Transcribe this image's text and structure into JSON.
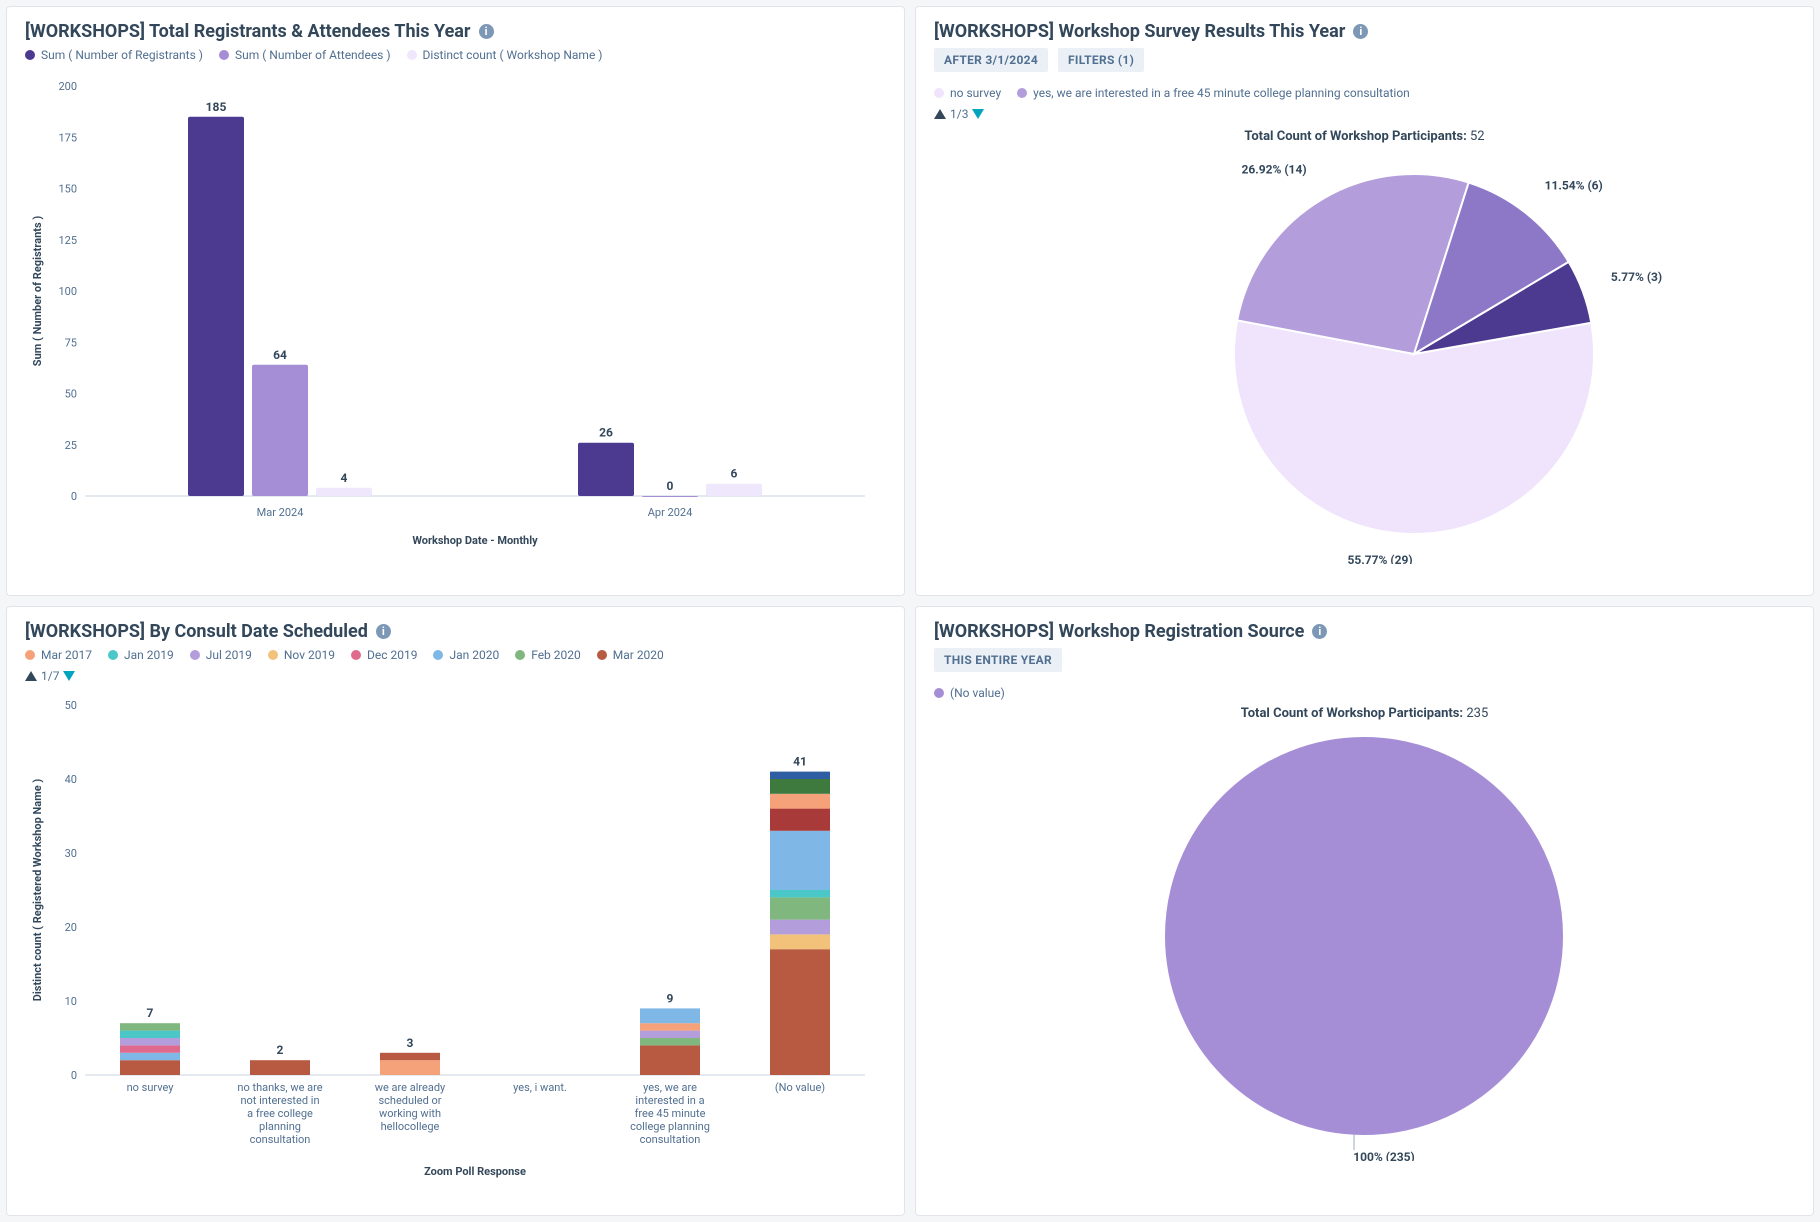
{
  "cards": {
    "topLeft": {
      "title": "[WORKSHOPS] Total Registrants & Attendees This Year",
      "legend": [
        "Sum ( Number of Registrants )",
        "Sum ( Number of Attendees )",
        "Distinct count ( Workshop Name )"
      ],
      "xlabel": "Workshop Date - Monthly",
      "ylabel": "Sum ( Number of Registrants )"
    },
    "topRight": {
      "title": "[WORKSHOPS] Workshop Survey Results This Year",
      "pill1": "AFTER 3/1/2024",
      "pill2": "FILTERS (1)",
      "legend": [
        "no survey",
        "yes, we are interested in a free 45 minute college planning consultation"
      ],
      "pager": "1/3",
      "header_prefix": "Total Count of Workshop Participants:",
      "header_count": "52"
    },
    "bottomLeft": {
      "title": "[WORKSHOPS] By Consult Date Scheduled",
      "legend": [
        "Mar 2017",
        "Jan 2019",
        "Jul 2019",
        "Nov 2019",
        "Dec 2019",
        "Jan 2020",
        "Feb 2020",
        "Mar 2020"
      ],
      "pager": "1/7",
      "xlabel": "Zoom Poll Response",
      "ylabel": "Distinct count ( Registered Workshop Name )"
    },
    "bottomRight": {
      "title": "[WORKSHOPS] Workshop Registration Source",
      "pill1": "THIS ENTIRE YEAR",
      "legend": [
        "(No value)"
      ],
      "header_prefix": "Total Count of Workshop Participants:",
      "header_count": "235",
      "slice_label": "100% (235)"
    }
  },
  "chart_data": [
    {
      "id": "top-left",
      "type": "bar",
      "title": "[WORKSHOPS] Total Registrants & Attendees This Year",
      "xlabel": "Workshop Date - Monthly",
      "ylabel": "Sum ( Number of Registrants )",
      "ylim": [
        0,
        200
      ],
      "yticks": [
        0,
        25,
        50,
        75,
        100,
        125,
        150,
        175,
        200
      ],
      "categories": [
        "Mar 2024",
        "Apr 2024"
      ],
      "series": [
        {
          "name": "Sum ( Number of Registrants )",
          "color": "#4b3a8f",
          "values": [
            185,
            26
          ]
        },
        {
          "name": "Sum ( Number of Attendees )",
          "color": "#a58ed6",
          "values": [
            64,
            0
          ]
        },
        {
          "name": "Distinct count ( Workshop Name )",
          "color": "#efe7fb",
          "values": [
            4,
            6
          ]
        }
      ]
    },
    {
      "id": "top-right",
      "type": "pie",
      "title": "[WORKSHOPS] Workshop Survey Results This Year",
      "total_label": "Total Count of Workshop Participants",
      "total": 52,
      "slices": [
        {
          "label": "55.77% (29)",
          "value": 29,
          "pct": 55.77,
          "color": "#efe4fb"
        },
        {
          "label": "26.92% (14)",
          "value": 14,
          "pct": 26.92,
          "color": "#b39ddb"
        },
        {
          "label": "11.54% (6)",
          "value": 6,
          "pct": 11.54,
          "color": "#8d78c8"
        },
        {
          "label": "5.77% (3)",
          "value": 3,
          "pct": 5.77,
          "color": "#4b3a8f"
        }
      ],
      "legend": [
        "no survey",
        "yes, we are interested in a free 45 minute college planning consultation"
      ]
    },
    {
      "id": "bottom-left",
      "type": "bar",
      "stacked": true,
      "title": "[WORKSHOPS] By Consult Date Scheduled",
      "xlabel": "Zoom Poll Response",
      "ylabel": "Distinct count ( Registered Workshop Name )",
      "ylim": [
        0,
        50
      ],
      "yticks": [
        0,
        10,
        20,
        30,
        40,
        50
      ],
      "categories": [
        "no survey",
        "no thanks, we are not interested in a free college planning consultation",
        "we are already scheduled or working with hellocollege",
        "yes, i want.",
        "yes, we are interested in a free 45 minute college planning consultation",
        "(No value)"
      ],
      "category_totals": [
        7,
        2,
        3,
        0,
        9,
        41
      ],
      "legend_colors": {
        "Mar 2017": "#f5a27a",
        "Jan 2019": "#4bc7c7",
        "Jul 2019": "#b39ddb",
        "Nov 2019": "#f2c27b",
        "Dec 2019": "#e06a8d",
        "Jan 2020": "#7fb7e6",
        "Feb 2020": "#7fb77e",
        "Mar 2020": "#b85a42"
      },
      "stacks": [
        [
          {
            "c": "#b85a42",
            "v": 2
          },
          {
            "c": "#7fb7e6",
            "v": 1
          },
          {
            "c": "#e06a8d",
            "v": 1
          },
          {
            "c": "#b39ddb",
            "v": 1
          },
          {
            "c": "#4bc7c7",
            "v": 1
          },
          {
            "c": "#7fb77e",
            "v": 1
          }
        ],
        [
          {
            "c": "#b85a42",
            "v": 2
          }
        ],
        [
          {
            "c": "#f5a27a",
            "v": 2
          },
          {
            "c": "#b85a42",
            "v": 1
          }
        ],
        [],
        [
          {
            "c": "#b85a42",
            "v": 4
          },
          {
            "c": "#7fb77e",
            "v": 1
          },
          {
            "c": "#b39ddb",
            "v": 1
          },
          {
            "c": "#f5a27a",
            "v": 1
          },
          {
            "c": "#7fb7e6",
            "v": 2
          }
        ],
        [
          {
            "c": "#b85a42",
            "v": 17
          },
          {
            "c": "#f2c27b",
            "v": 2
          },
          {
            "c": "#b39ddb",
            "v": 2
          },
          {
            "c": "#7fb77e",
            "v": 3
          },
          {
            "c": "#4bc7c7",
            "v": 1
          },
          {
            "c": "#7fb7e6",
            "v": 8
          },
          {
            "c": "#a93a3a",
            "v": 3
          },
          {
            "c": "#f5a27a",
            "v": 2
          },
          {
            "c": "#3e7a3e",
            "v": 2
          },
          {
            "c": "#2f5fa3",
            "v": 1
          }
        ]
      ]
    },
    {
      "id": "bottom-right",
      "type": "pie",
      "title": "[WORKSHOPS] Workshop Registration Source",
      "total_label": "Total Count of Workshop Participants",
      "total": 235,
      "slices": [
        {
          "label": "100% (235)",
          "value": 235,
          "pct": 100,
          "color": "#a58ed6"
        }
      ],
      "legend": [
        "(No value)"
      ]
    }
  ]
}
